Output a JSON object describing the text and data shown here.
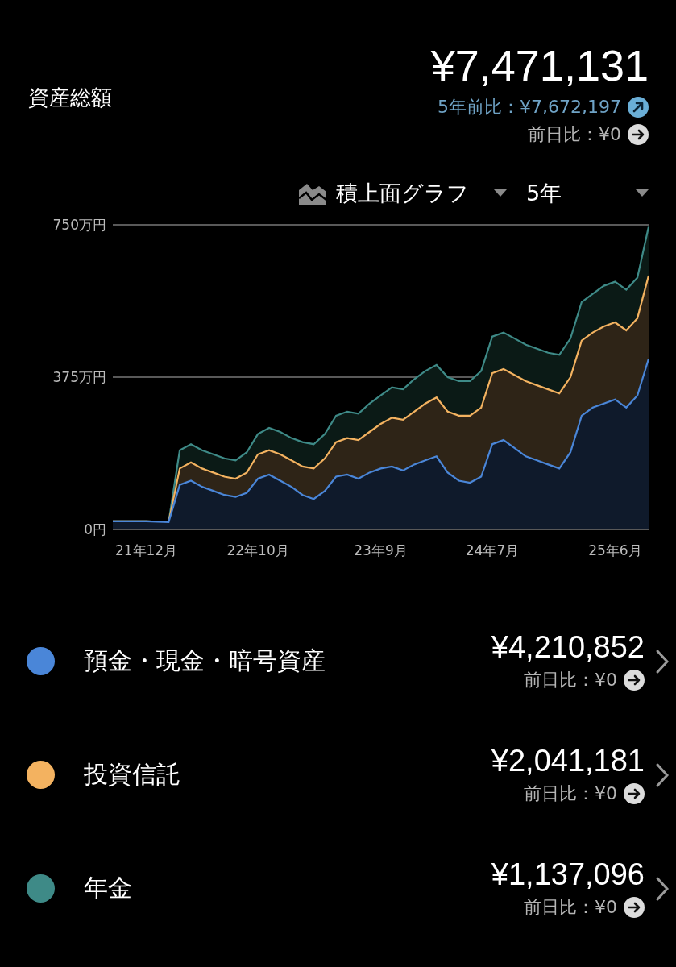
{
  "summary": {
    "label": "資産総額",
    "total": "¥7,471,131",
    "comparisons": [
      {
        "kind": "up",
        "label": "5年前比：¥7,672,197"
      },
      {
        "kind": "flat",
        "label": "前日比：¥0"
      }
    ]
  },
  "controls": [
    {
      "kind": "chart-type",
      "label": "積上面グラフ"
    },
    {
      "kind": "period",
      "label": "5年"
    }
  ],
  "chart_data": {
    "type": "area",
    "stacked": true,
    "ylim": [
      0,
      750
    ],
    "yticks": [
      {
        "value": 0,
        "label": "0円"
      },
      {
        "value": 375,
        "label": "375万円"
      },
      {
        "value": 750,
        "label": "750万円"
      }
    ],
    "categories": [
      null,
      null,
      null,
      "21年12月",
      null,
      null,
      null,
      null,
      null,
      null,
      null,
      null,
      null,
      "22年10月",
      null,
      null,
      null,
      null,
      null,
      null,
      null,
      null,
      null,
      null,
      "23年9月",
      null,
      null,
      null,
      null,
      null,
      null,
      null,
      null,
      null,
      "24年7月",
      null,
      null,
      null,
      null,
      null,
      null,
      null,
      null,
      null,
      null,
      "25年6月",
      null,
      null,
      null
    ],
    "series": [
      {
        "color": "#4a86d8",
        "values": [
          20,
          20,
          20,
          20,
          19,
          18,
          110,
          120,
          105,
          95,
          85,
          80,
          90,
          125,
          135,
          120,
          105,
          85,
          75,
          95,
          130,
          135,
          125,
          140,
          150,
          155,
          145,
          160,
          170,
          180,
          140,
          120,
          115,
          130,
          210,
          220,
          200,
          180,
          170,
          160,
          150,
          190,
          280,
          300,
          310,
          320,
          300,
          330,
          420
        ]
      },
      {
        "color": "#f3b260",
        "values": [
          0,
          0,
          0,
          0,
          0,
          0,
          40,
          45,
          45,
          45,
          45,
          45,
          50,
          60,
          60,
          65,
          65,
          70,
          75,
          80,
          85,
          90,
          95,
          100,
          110,
          120,
          125,
          130,
          140,
          145,
          150,
          160,
          165,
          170,
          175,
          175,
          180,
          185,
          185,
          185,
          185,
          185,
          185,
          185,
          190,
          190,
          190,
          190,
          205
        ]
      },
      {
        "color": "#3e8a87",
        "values": [
          0,
          0,
          0,
          0,
          0,
          0,
          45,
          45,
          45,
          45,
          45,
          45,
          50,
          50,
          55,
          55,
          55,
          60,
          60,
          60,
          65,
          65,
          65,
          70,
          70,
          75,
          75,
          80,
          80,
          80,
          85,
          85,
          85,
          90,
          90,
          90,
          90,
          90,
          90,
          90,
          95,
          95,
          95,
          95,
          100,
          100,
          100,
          100,
          120
        ]
      }
    ]
  },
  "categories": [
    {
      "name": "預金・現金・暗号資産",
      "color": "#4a86d8",
      "amount": "¥4,210,852",
      "change": "前日比：¥0"
    },
    {
      "name": "投資信託",
      "color": "#f3b260",
      "amount": "¥2,041,181",
      "change": "前日比：¥0"
    },
    {
      "name": "年金",
      "color": "#3e8a87",
      "amount": "¥1,137,096",
      "change": "前日比：¥0"
    }
  ]
}
